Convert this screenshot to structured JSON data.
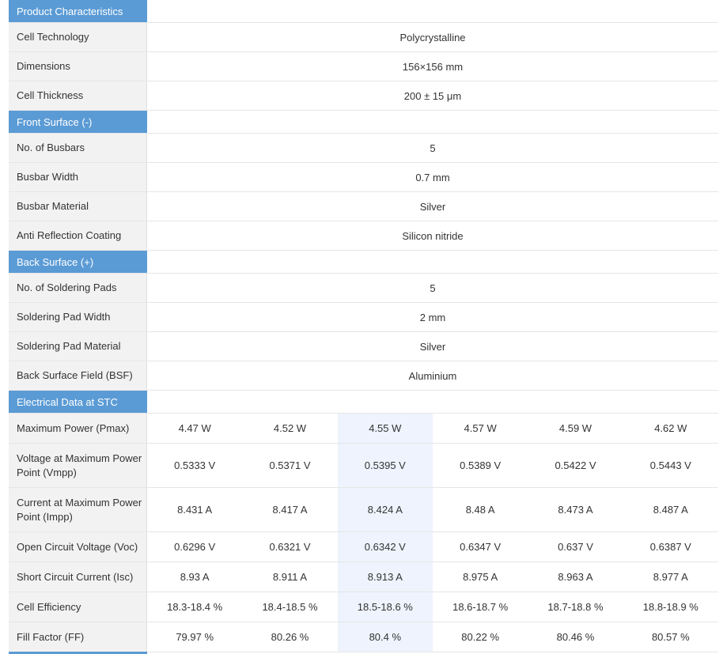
{
  "sections": {
    "product": "Product Characteristics",
    "front": "Front Surface (-)",
    "back": "Back Surface (+)",
    "electrical": "Electrical Data at STC"
  },
  "product": [
    {
      "label": "Cell Technology",
      "value": "Polycrystalline"
    },
    {
      "label": "Dimensions",
      "value": "156×156 mm"
    },
    {
      "label": "Cell Thickness",
      "value": "200 ± 15 μm"
    }
  ],
  "front": [
    {
      "label": "No. of Busbars",
      "value": "5"
    },
    {
      "label": "Busbar Width",
      "value": "0.7 mm"
    },
    {
      "label": "Busbar Material",
      "value": "Silver"
    },
    {
      "label": "Anti Reflection Coating",
      "value": "Silicon nitride"
    }
  ],
  "back": [
    {
      "label": "No. of Soldering Pads",
      "value": "5"
    },
    {
      "label": "Soldering Pad Width",
      "value": "2 mm"
    },
    {
      "label": "Soldering Pad Material",
      "value": "Silver"
    },
    {
      "label": "Back Surface Field (BSF)",
      "value": "Aluminium"
    }
  ],
  "electrical": [
    {
      "label": "Maximum Power (Pmax)",
      "values": [
        "4.47 W",
        "4.52 W",
        "4.55 W",
        "4.57 W",
        "4.59 W",
        "4.62 W"
      ]
    },
    {
      "label": "Voltage at Maximum Power Point (Vmpp)",
      "values": [
        "0.5333 V",
        "0.5371 V",
        "0.5395 V",
        "0.5389 V",
        "0.5422 V",
        "0.5443 V"
      ]
    },
    {
      "label": "Current at Maximum Power Point (Impp)",
      "values": [
        "8.431 A",
        "8.417 A",
        "8.424 A",
        "8.48 A",
        "8.473 A",
        "8.487 A"
      ]
    },
    {
      "label": "Open Circuit Voltage (Voc)",
      "values": [
        "0.6296 V",
        "0.6321 V",
        "0.6342 V",
        "0.6347 V",
        "0.637 V",
        "0.6387 V"
      ]
    },
    {
      "label": "Short Circuit Current (Isc)",
      "values": [
        "8.93 A",
        "8.911 A",
        "8.913 A",
        "8.975 A",
        "8.963 A",
        "8.977 A"
      ]
    },
    {
      "label": "Cell Efficiency",
      "values": [
        "18.3-18.4 %",
        "18.4-18.5 %",
        "18.5-18.6 %",
        "18.6-18.7 %",
        "18.7-18.8 %",
        "18.8-18.9 %"
      ]
    },
    {
      "label": "Fill Factor (FF)",
      "values": [
        "79.97 %",
        "80.26 %",
        "80.4 %",
        "80.22 %",
        "80.46 %",
        "80.57 %"
      ]
    }
  ],
  "colors": {
    "section_header": "#5b9bd5",
    "label_bg": "#f2f2f2",
    "highlight_column": "#eef3fd"
  }
}
